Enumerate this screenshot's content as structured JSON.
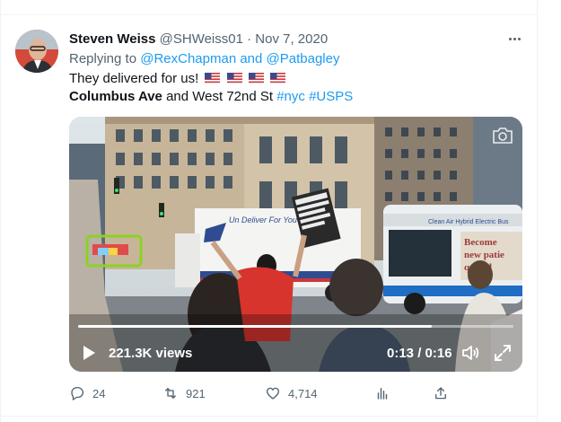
{
  "tweet": {
    "author_name": "Steven Weiss",
    "handle": "@SHWeiss01",
    "separator": "·",
    "date": "Nov 7, 2020",
    "replying_prefix": "Replying to ",
    "replying_mentions": "@RexChapman and @Patbagley",
    "text_line1": "They delivered for us!",
    "text_line2_bold": "Columbus Ave",
    "text_line2_rest": " and West 72nd St ",
    "hashtags": "#nyc #USPS"
  },
  "video": {
    "views_label": "221.3K views",
    "time_label": "0:13 / 0:16",
    "progress_fraction": 0.8125,
    "truck_text": "Un Deliver For You",
    "sign_text": "HELP ME SAVE THE POST OFFICE",
    "bus_text": "Clean Air Hybrid Electric Bus",
    "bus_ad_text": "Become new patie quired"
  },
  "actions": {
    "replies": "24",
    "retweets": "921",
    "likes": "4,714"
  },
  "icons": [
    "more-icon",
    "flag-icon",
    "camera-icon",
    "play-icon",
    "volume-icon",
    "fullscreen-icon",
    "reply-icon",
    "retweet-icon",
    "like-icon",
    "analytics-icon",
    "share-icon"
  ],
  "colors": {
    "accent": "#1d9bf0",
    "muted": "#536471",
    "highlight_box": "#8bd320"
  }
}
